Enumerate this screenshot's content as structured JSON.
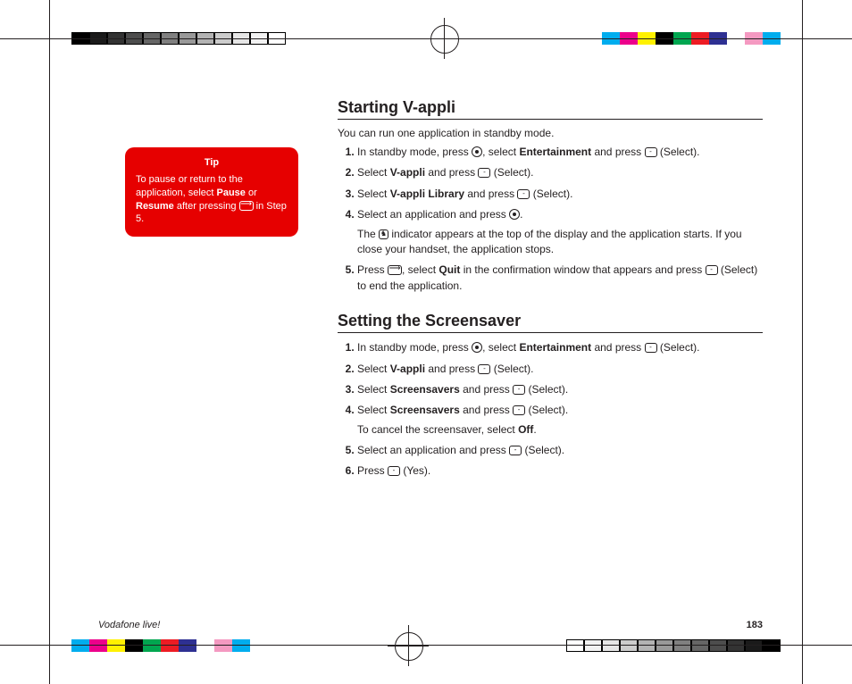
{
  "colors": {
    "tip_bg": "#e60000",
    "grays": [
      "#000000",
      "#1a1a1a",
      "#333333",
      "#4d4d4d",
      "#666666",
      "#808080",
      "#999999",
      "#b3b3b3",
      "#cccccc",
      "#e6e6e6",
      "#f2f2f2",
      "#ffffff"
    ],
    "swatches": [
      "#00adee",
      "#ec008b",
      "#fff100",
      "#000000",
      "#00a650",
      "#ed1c24",
      "#2e3092",
      "#ffffff",
      "#f499c1",
      "#00adee"
    ]
  },
  "tip": {
    "title": "Tip",
    "before": "To pause or return to the application, select ",
    "b1": "Pause",
    "mid": " or ",
    "b2": "Resume",
    "after1": " after pressing ",
    "after2": " in Step 5."
  },
  "s1": {
    "heading": "Starting V-appli",
    "intro": "You can run one application in standby mode.",
    "i1a": "In standby mode, press ",
    "i1b": ", select ",
    "i1c": "Entertainment",
    "i1d": " and press ",
    "i1e": " (Select).",
    "i2a": "Select ",
    "i2b": "V-appli",
    "i2c": " and press ",
    "i2d": " (Select).",
    "i3a": "Select ",
    "i3b": "V-appli Library",
    "i3c": " and press ",
    "i3d": " (Select).",
    "i4a": "Select an application and press ",
    "i4b": ".",
    "i4note1": "The ",
    "i4note2": " indicator appears at the top of the display and the application starts. If you close your handset, the application stops.",
    "i5a": "Press ",
    "i5b": ", select ",
    "i5c": "Quit",
    "i5d": " in the confirmation window that appears and press ",
    "i5e": " (Select) to end the application."
  },
  "s2": {
    "heading": "Setting the Screensaver",
    "i1a": "In standby mode, press ",
    "i1b": ", select ",
    "i1c": "Entertainment",
    "i1d": " and press ",
    "i1e": " (Select).",
    "i2a": "Select ",
    "i2b": "V-appli",
    "i2c": " and press ",
    "i2d": " (Select).",
    "i3a": "Select ",
    "i3b": "Screensavers",
    "i3c": " and press ",
    "i3d": " (Select).",
    "i4a": "Select ",
    "i4b": "Screensavers",
    "i4c": " and press ",
    "i4d": " (Select).",
    "i4note1": "To cancel the screensaver, select ",
    "i4note2": "Off",
    "i4note3": ".",
    "i5a": "Select an application and press ",
    "i5b": " (Select).",
    "i6a": "Press ",
    "i6b": " (Yes)."
  },
  "footer": {
    "brand": "Vodafone live!",
    "page": "183"
  }
}
